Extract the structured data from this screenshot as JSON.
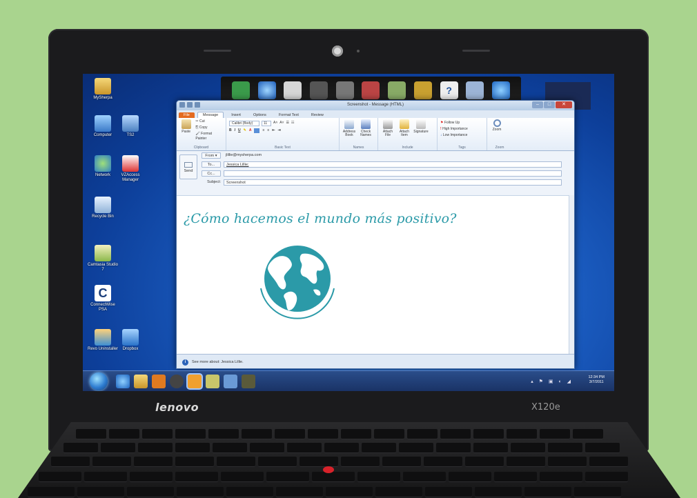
{
  "laptop": {
    "brand": "lenovo",
    "model": "X120e"
  },
  "desktop_icons": [
    {
      "label": "MySherpa"
    },
    {
      "label": "Computer"
    },
    {
      "label": "TS2"
    },
    {
      "label": "Network"
    },
    {
      "label": "VZAccess Manager"
    },
    {
      "label": "Recycle Bin"
    },
    {
      "label": "Camtasia Studio 7"
    },
    {
      "label": "ConnectWise PSA"
    },
    {
      "label": "Revo Uninstaller"
    },
    {
      "label": "Dropbox"
    }
  ],
  "window": {
    "title": "Screenshot - Message (HTML)",
    "tabs": [
      "File",
      "Message",
      "Insert",
      "Options",
      "Format Text",
      "Review"
    ],
    "active_tab": "Message"
  },
  "ribbon": {
    "clipboard": {
      "paste": "Paste",
      "cut": "Cut",
      "copy": "Copy",
      "format_painter": "Format Painter",
      "group": "Clipboard"
    },
    "basic_text": {
      "font": "Calibri (Body)",
      "size": "11",
      "group": "Basic Text"
    },
    "names": {
      "address_book": "Address Book",
      "check_names": "Check Names",
      "group": "Names"
    },
    "include": {
      "attach_file": "Attach File",
      "attach_item": "Attach Item",
      "signature": "Signature",
      "group": "Include"
    },
    "tags": {
      "follow_up": "Follow Up",
      "high_importance": "High Importance",
      "low_importance": "Low Importance",
      "group": "Tags"
    },
    "zoom": {
      "zoom": "Zoom",
      "group": "Zoom"
    }
  },
  "message": {
    "send_label": "Send",
    "from_label": "From",
    "from_value": "jlillie@mysherpa.com",
    "to_label": "To...",
    "to_value": "Jessica Lillie;",
    "cc_label": "Cc...",
    "cc_value": "",
    "subject_label": "Subject:",
    "subject_value": "Screenshot",
    "body_heading": "¿Cómo hacemos el mundo más positivo?"
  },
  "status_bar": {
    "text": "See more about: Jessica Lillie."
  },
  "taskbar": {
    "time": "12:34 PM",
    "date": "3/7/2011"
  },
  "colors": {
    "accent_teal": "#2b9aa8",
    "file_tab": "#e46a1f",
    "background": "#a9d48e"
  }
}
